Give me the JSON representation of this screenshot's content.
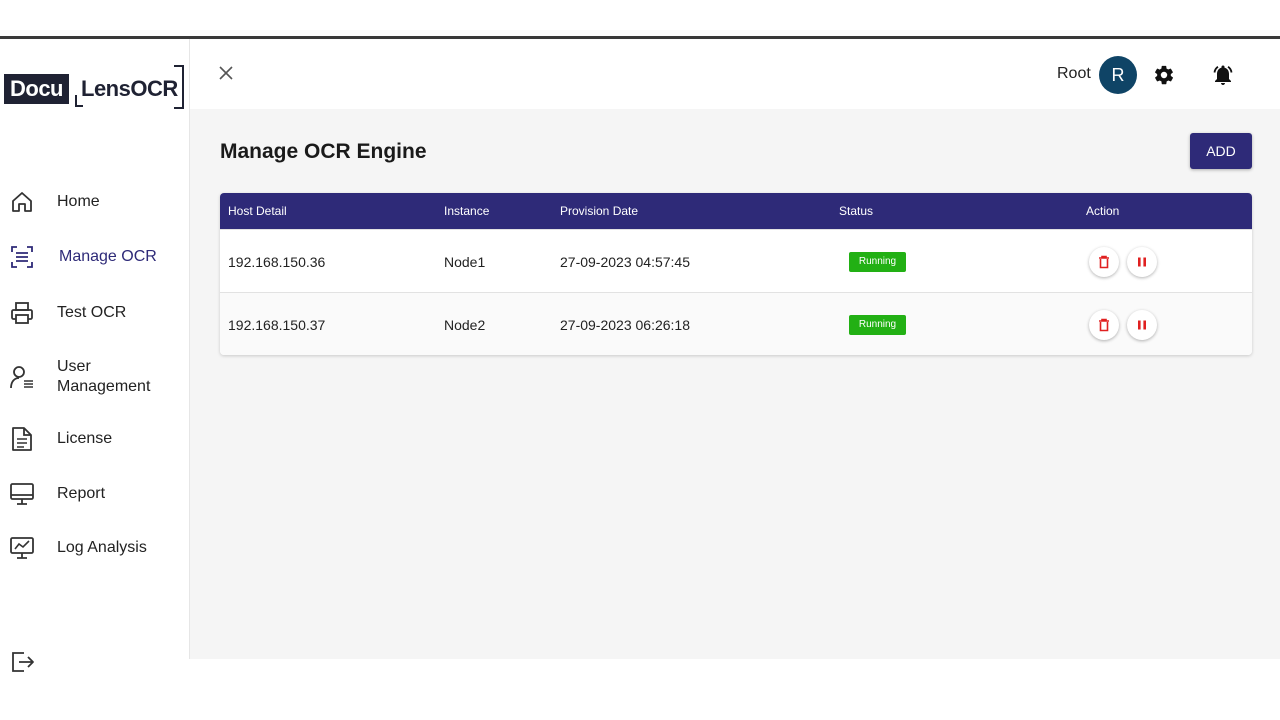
{
  "app": {
    "logo_part1": "Docu",
    "logo_part2": "LensOCR"
  },
  "sidebar": {
    "items": [
      {
        "label": "Home",
        "icon": "home-icon"
      },
      {
        "label": "Manage OCR",
        "icon": "scan-icon",
        "active": true
      },
      {
        "label": "Test OCR",
        "icon": "printer-icon"
      },
      {
        "label": "User\nManagement",
        "icon": "user-list-icon"
      },
      {
        "label": "License",
        "icon": "document-icon"
      },
      {
        "label": "Report",
        "icon": "monitor-icon"
      },
      {
        "label": "Log Analysis",
        "icon": "chart-monitor-icon"
      }
    ],
    "logout_icon": "logout-icon"
  },
  "header": {
    "close_icon": "close-icon",
    "user_name": "Root",
    "avatar_initial": "R",
    "settings_icon": "gear-icon",
    "notifications_icon": "bell-icon",
    "avatar_color": "#0f4466"
  },
  "main": {
    "title": "Manage OCR Engine",
    "add_label": "ADD",
    "table": {
      "columns": [
        "Host Detail",
        "Instance",
        "Provision Date",
        "Status",
        "Action"
      ],
      "rows": [
        {
          "host": "192.168.150.36",
          "instance": "Node1",
          "date": "27-09-2023 04:57:45",
          "status": "Running"
        },
        {
          "host": "192.168.150.37",
          "instance": "Node2",
          "date": "27-09-2023 06:26:18",
          "status": "Running"
        }
      ]
    }
  },
  "colors": {
    "accent": "#2e2a78",
    "status_running": "#22b014",
    "action_red": "#e02020"
  }
}
